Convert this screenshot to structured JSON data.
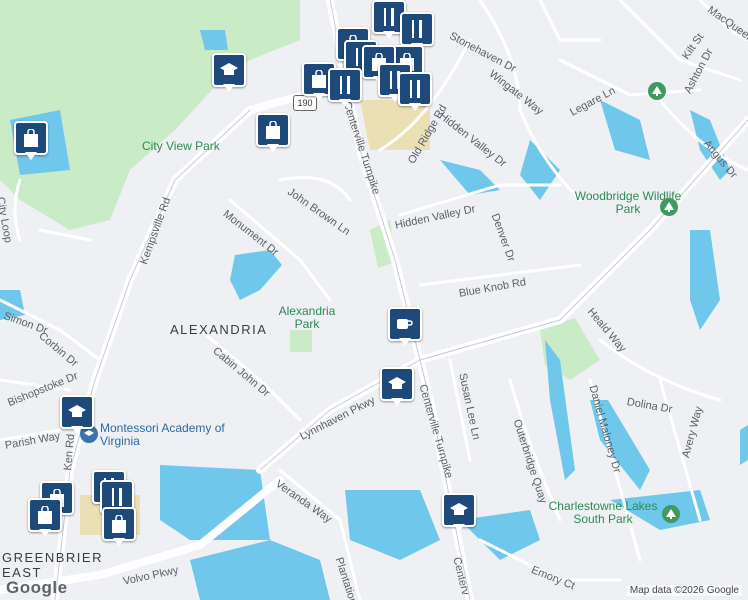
{
  "map": {
    "route_shield": "190",
    "streets": {
      "kempsville_rd_1": "Kempsville Rd",
      "kempsville_rd_2": "Ken   Rd",
      "centerville_tpk_1": "Centerville Turnpike",
      "centerville_tpk_2": "Centerville Turnpike",
      "centerville_tpk_3": "Centerv",
      "lynnhaven_pkwy": "Lynnhaven Pkwy",
      "volvo_pkwy": "Volvo Pkwy",
      "john_brown_ln": "John Brown Ln",
      "monument_dr": "Monument Dr",
      "hidden_valley_dr_1": "Hidden Valley Dr",
      "hidden_valley_dr_2": "Hidden Valley Dr",
      "old_ridge_rd": "Old Ridge Rd",
      "blue_knob_rd": "Blue Knob Rd",
      "denver_dr": "Denver Dr",
      "stonehaven_dr": "Stonehaven Dr",
      "wingate_way": "Wingate Way",
      "legare_ln": "Legare Ln",
      "ashton_dr": "Ashton Dr",
      "kilt_st": "Kilt St",
      "macqueen": "MacQueen",
      "angus_dr": "Angus Dr",
      "heald_way": "Heald Way",
      "dolina_dr": "Dolina Dr",
      "avery_way": "Avery Way",
      "daniel_maloney_dr": "Daniel Maloney Dr",
      "outerbridge_quay": "Outerbridge Quay",
      "susan_lee_ln": "Susan Lee Ln",
      "cabin_john_dr": "Cabin John Dr",
      "simon_dr": "Simon Dr",
      "corbin_dr": "Corbin Dr",
      "bishopstoke_dr": "Bishopstoke Dr",
      "parish_way": "Parish Way",
      "veranda_way": "Veranda Way",
      "plantation": "Plantation",
      "emory_ct": "Emory Ct",
      "city_loop": "City Loop"
    },
    "places": {
      "city_view_park": "City View Park",
      "woodbridge_park": "Woodbridge Wildlife Park",
      "alexandria_park": "Alexandria Park",
      "charlestowne_park": "Charlestowne Lakes South Park",
      "alexandria_area": "ALEXANDRIA",
      "greenbrier_area": "GREENBRIER EAST",
      "montessori": "Montessori Academy of Virginia"
    },
    "markers": [
      {
        "type": "school",
        "name": "school-marker-1"
      },
      {
        "type": "shopping",
        "name": "shopping-marker-1"
      },
      {
        "type": "shopping",
        "name": "shopping-marker-2"
      },
      {
        "type": "restaurant",
        "name": "restaurant-marker-1"
      },
      {
        "type": "coffee",
        "name": "coffee-marker"
      },
      {
        "type": "school",
        "name": "school-marker-2"
      },
      {
        "type": "school",
        "name": "school-marker-3"
      },
      {
        "type": "school",
        "name": "school-marker-4"
      }
    ],
    "colors": {
      "background": "#eef0f4",
      "park": "#c9ecc6",
      "water": "#6fc8eb",
      "road": "#ffffff",
      "marker": "#1d4a7a"
    },
    "attribution": "Map data ©2026 Google",
    "logo": "Google"
  }
}
